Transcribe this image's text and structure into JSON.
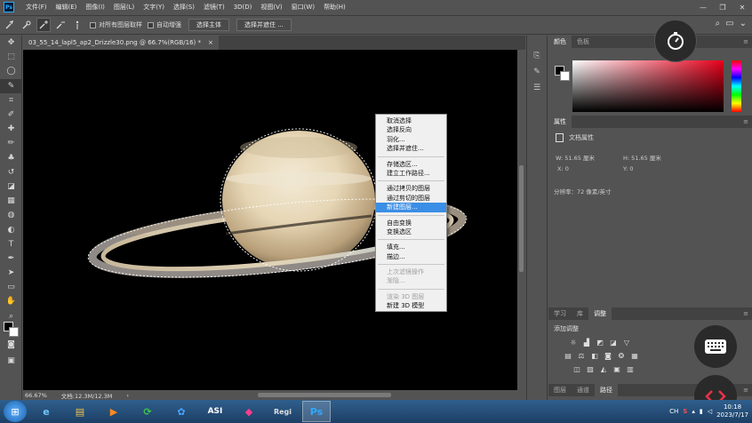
{
  "menubar": {
    "logo": "Ps",
    "items": [
      "文件(F)",
      "编辑(E)",
      "图像(I)",
      "图层(L)",
      "文字(Y)",
      "选择(S)",
      "滤镜(T)",
      "3D(D)",
      "视图(V)",
      "窗口(W)",
      "帮助(H)"
    ]
  },
  "window_controls": {
    "minimize": "—",
    "restore": "❐",
    "close": "✕"
  },
  "options": {
    "sample_all_layers": "对所有图层取样",
    "auto_enhance": "自动增强",
    "select_subject": "选择主体",
    "select_and_mask": "选择并遮住 ..."
  },
  "document": {
    "tab_title": "03_55_14_lapl5_ap2_Drizzle30.png @ 66.7%(RGB/16) *",
    "tab_close": "×"
  },
  "status": {
    "zoom": "66.67%",
    "doc_size": "文档:12.3M/12.3M",
    "arrow": "›"
  },
  "context_menu": {
    "items": [
      {
        "label": "取消选择",
        "state": "normal"
      },
      {
        "label": "选择反向",
        "state": "normal"
      },
      {
        "label": "羽化...",
        "state": "normal"
      },
      {
        "label": "选择并遮住...",
        "state": "normal"
      },
      {
        "label": "存储选区...",
        "state": "normal"
      },
      {
        "label": "建立工作路径...",
        "state": "normal"
      },
      {
        "label": "通过拷贝的图层",
        "state": "normal"
      },
      {
        "label": "通过剪切的图层",
        "state": "normal"
      },
      {
        "label": "新建图层...",
        "state": "highlighted"
      },
      {
        "label": "自由变换",
        "state": "normal"
      },
      {
        "label": "变换选区",
        "state": "normal"
      },
      {
        "label": "填充...",
        "state": "normal"
      },
      {
        "label": "描边...",
        "state": "normal"
      },
      {
        "label": "上次滤镜操作",
        "state": "disabled"
      },
      {
        "label": "渐隐...",
        "state": "disabled"
      },
      {
        "label": "渲染 3D 图层",
        "state": "disabled"
      },
      {
        "label": "新建 3D 模型",
        "state": "normal"
      }
    ]
  },
  "color_panel": {
    "tabs": [
      "颜色",
      "色板"
    ],
    "hue_color": "#e8001b"
  },
  "properties_panel": {
    "tab": "属性",
    "title": "文档属性",
    "w": "W:  51.65 厘米",
    "h": "H:  51.65 厘米",
    "x": "X:  0",
    "y": "Y:  0",
    "resolution": "分辨率：72 像素/英寸"
  },
  "adjustments_panel": {
    "tabs": [
      "学习",
      "库",
      "调整"
    ],
    "title": "添加调整"
  },
  "bottom_panel": {
    "tabs": [
      "图层",
      "通道",
      "路径"
    ]
  },
  "taskbar": {
    "apps": [
      {
        "name": "internet-explorer",
        "glyph": "e"
      },
      {
        "name": "file-explorer",
        "glyph": "▤"
      },
      {
        "name": "media-player",
        "glyph": "▶"
      },
      {
        "name": "app-green",
        "glyph": "⟳"
      },
      {
        "name": "app-blue",
        "glyph": "✿"
      },
      {
        "name": "asi-studio",
        "glyph": "ASI"
      },
      {
        "name": "app-pink",
        "glyph": "◆"
      },
      {
        "name": "registax",
        "glyph": "Regi"
      },
      {
        "name": "photoshop",
        "glyph": "Ps"
      }
    ],
    "ime": "CH",
    "time": "10:18",
    "date": "2023/7/17"
  }
}
